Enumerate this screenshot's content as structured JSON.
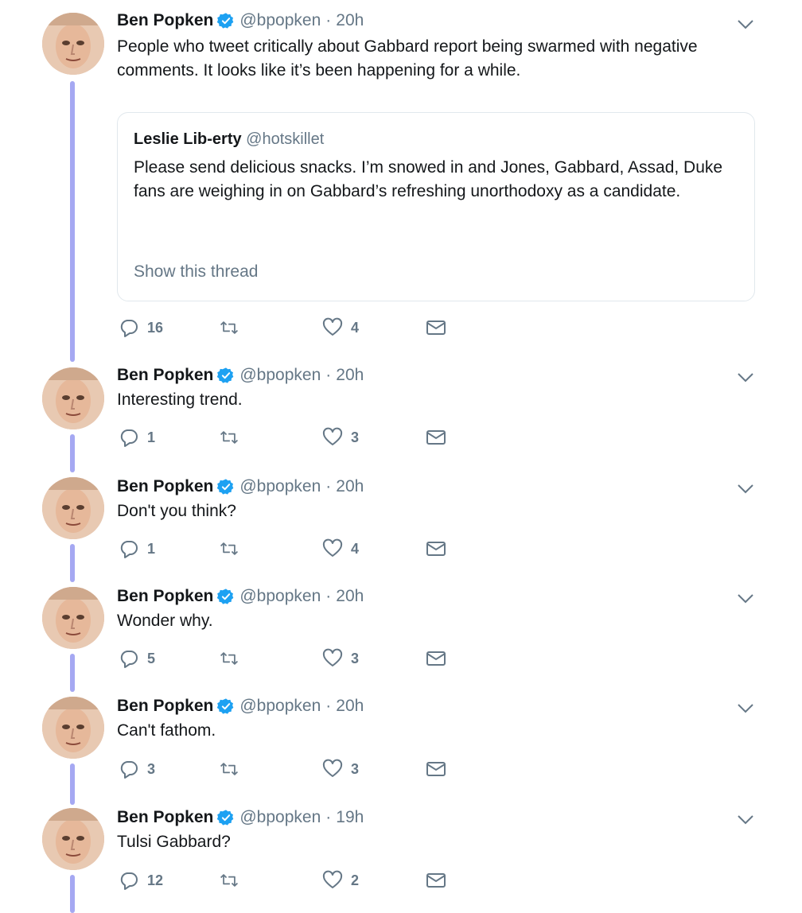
{
  "tweets": [
    {
      "name": "Ben Popken",
      "handle": "@bpopken",
      "dot": "·",
      "time": "20h",
      "text": "People who tweet critically about Gabbard report being swarmed with negative comments. It looks like it’s been happening for a while.",
      "quote": {
        "name": "Leslie Lib-erty",
        "handle": "@hotskillet",
        "text": "Please send delicious snacks. I’m snowed in and Jones, Gabbard, Assad, Duke fans are weighing in on Gabbard’s refreshing unorthodoxy as a candidate.",
        "show_thread": "Show this thread"
      },
      "replies": "16",
      "retweets": "",
      "likes": "4"
    },
    {
      "name": "Ben Popken",
      "handle": "@bpopken",
      "dot": "·",
      "time": "20h",
      "text": "Interesting trend.",
      "replies": "1",
      "retweets": "",
      "likes": "3"
    },
    {
      "name": "Ben Popken",
      "handle": "@bpopken",
      "dot": "·",
      "time": "20h",
      "text": "Don't you think?",
      "replies": "1",
      "retweets": "",
      "likes": "4"
    },
    {
      "name": "Ben Popken",
      "handle": "@bpopken",
      "dot": "·",
      "time": "20h",
      "text": "Wonder why.",
      "replies": "5",
      "retweets": "",
      "likes": "3"
    },
    {
      "name": "Ben Popken",
      "handle": "@bpopken",
      "dot": "·",
      "time": "20h",
      "text": "Can't fathom.",
      "replies": "3",
      "retweets": "",
      "likes": "3"
    },
    {
      "name": "Ben Popken",
      "handle": "@bpopken",
      "dot": "·",
      "time": "19h",
      "text": "Tulsi Gabbard?",
      "replies": "12",
      "retweets": "",
      "likes": "2"
    }
  ],
  "colors": {
    "thread_line": "#a5a8f2",
    "verified": "#1da1f2",
    "muted": "#657786",
    "text": "#14171a",
    "border": "#e1e8ed"
  },
  "icons": [
    "verified-badge-icon",
    "chevron-down-icon",
    "reply-icon",
    "retweet-icon",
    "like-icon",
    "dm-icon"
  ]
}
